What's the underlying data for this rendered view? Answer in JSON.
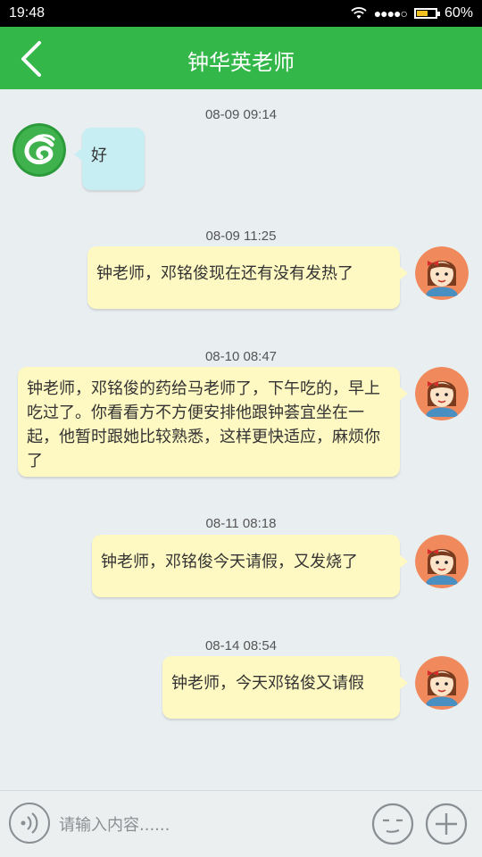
{
  "status_bar": {
    "time": "19:48",
    "battery": "60%",
    "signal_dots": "●●●●○"
  },
  "header": {
    "title": "钟华英老师"
  },
  "messages": [
    {
      "timestamp": "08-09 09:14",
      "text": "好"
    },
    {
      "timestamp": "08-09 11:25",
      "text": "钟老师，邓铭俊现在还有没有发热了"
    },
    {
      "timestamp": "08-10 08:47",
      "text": "钟老师，邓铭俊的药给马老师了，下午吃的，早上吃过了。你看看方不方便安排他跟钟荟宜坐在一起，他暂时跟她比较熟悉，这样更快适应，麻烦你了"
    },
    {
      "timestamp": "08-11 08:18",
      "text": "钟老师，邓铭俊今天请假，又发烧了"
    },
    {
      "timestamp": "08-14 08:54",
      "text": "钟老师，今天邓铭俊又请假"
    }
  ],
  "input": {
    "placeholder": "请输入内容......"
  },
  "colors": {
    "header": "#34b749",
    "incoming_bubble": "#c7eef3",
    "outgoing_bubble": "#fef8c2",
    "background": "#e9eef0"
  }
}
